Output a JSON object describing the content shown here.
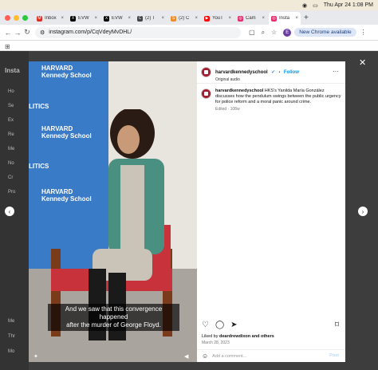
{
  "menubar": {
    "datetime": "Thu Apr 24  1:08 PM"
  },
  "tabs": [
    {
      "label": "Inbox",
      "color": "#d93025",
      "icon": "M"
    },
    {
      "label": "EVW",
      "color": "#000000",
      "icon": "X"
    },
    {
      "label": "EVW",
      "color": "#000000",
      "icon": "X"
    },
    {
      "label": "(2) T",
      "color": "#444444",
      "icon": "C"
    },
    {
      "label": "(2) C",
      "color": "#f28c28",
      "icon": "S"
    },
    {
      "label": "YouT",
      "color": "#ff0000",
      "icon": "▶"
    },
    {
      "label": "Cam",
      "color": "#e1306c",
      "icon": "◎"
    },
    {
      "label": "Insta",
      "color": "#e1306c",
      "icon": "◎",
      "active": true
    }
  ],
  "address": {
    "url": "instagram.com/p/CqVdeyMvDHL/",
    "new_chrome": "New Chrome available",
    "avatar": "E"
  },
  "sidebar": {
    "items": [
      "Ho",
      "Se",
      "Ex",
      "Re",
      "Me",
      "No",
      "Cr",
      "Pro"
    ],
    "bottom": [
      "Me",
      "Thr",
      "Mo"
    ],
    "logo": "Insta"
  },
  "video": {
    "brand": "HARVARD",
    "school": "Kennedy School",
    "politics": "LITICS",
    "caption_line1": "And we saw that this convergence happened",
    "caption_line2": "after the murder of George Floyd."
  },
  "post": {
    "username": "harvardkennedyschool",
    "follow": "Follow",
    "audio": "Original audio",
    "text": "HKS's Yanilda María González discusses how the pendulum swings between the public urgency for police reform and a moral panic around crime.",
    "meta": "Edited · 108w",
    "liked_prefix": "Liked by ",
    "liked_user": "deardrewdixon",
    "liked_suffix": " and others",
    "date": "March 28, 2023",
    "comment_placeholder": "Add a comment...",
    "post_btn": "Post"
  }
}
